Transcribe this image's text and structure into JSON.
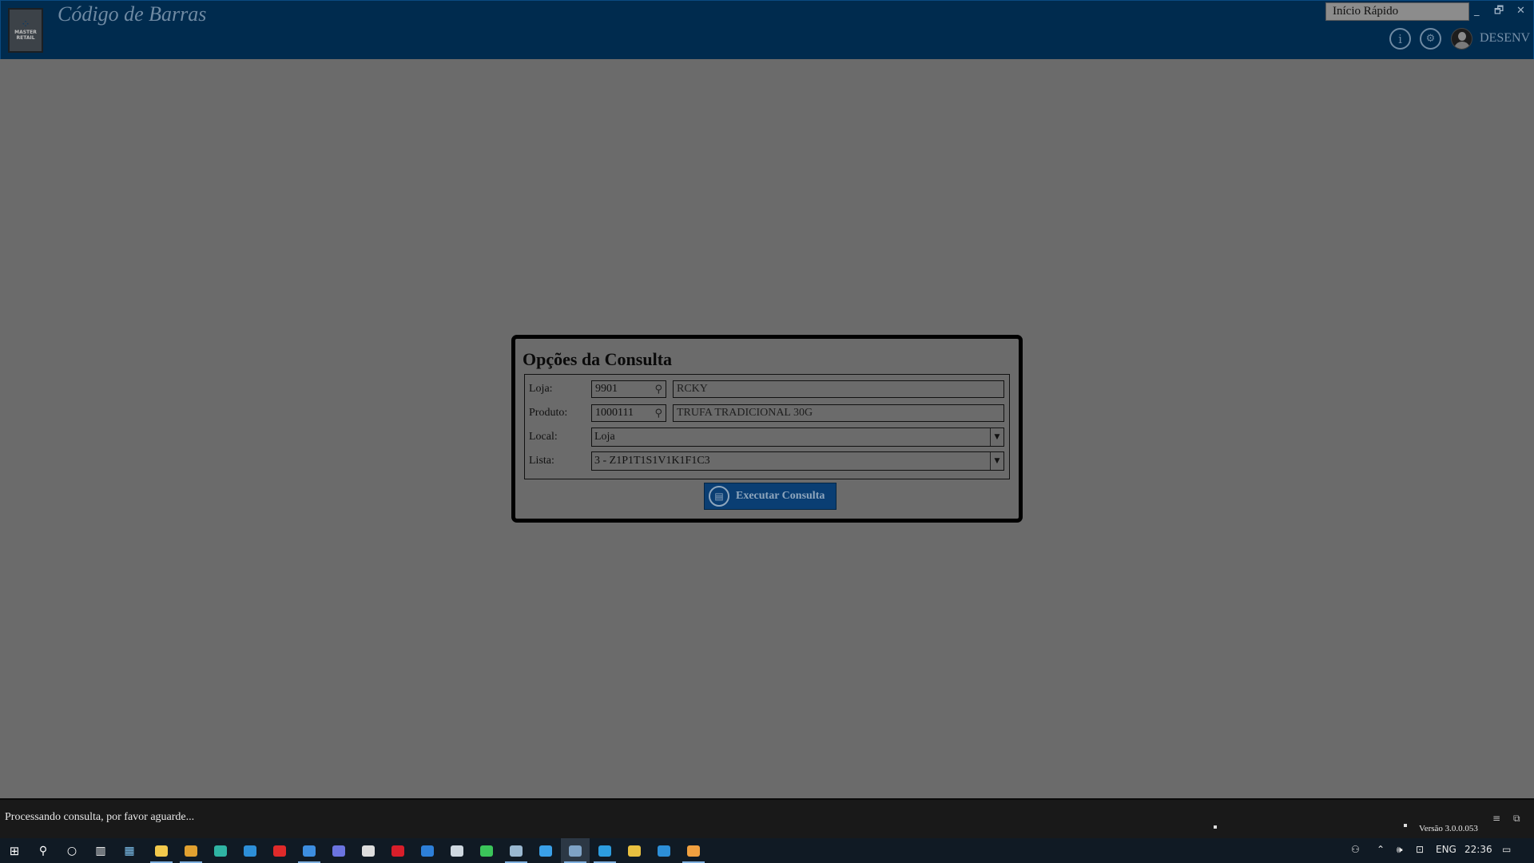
{
  "app": {
    "title": "Código de Barras",
    "logo_text": "MASTER RETAIL",
    "quick_start": "Início Rápido",
    "user": "DESENV",
    "window_controls": {
      "minimize": "_",
      "restore": "🗗",
      "close": "✕"
    }
  },
  "dialog": {
    "title": "Opções da Consulta",
    "loja": {
      "label": "Loja:",
      "code": "9901",
      "description": "RCKY"
    },
    "produto": {
      "label": "Produto:",
      "code": "1000111",
      "description": "TRUFA TRADICIONAL 30G"
    },
    "local": {
      "label": "Local:",
      "value": "Loja"
    },
    "lista": {
      "label": "Lista:",
      "value": "3 - Z1P1T1S1V1K1F1C3"
    },
    "execute_button": "Executar Consulta"
  },
  "status": {
    "message": "Processando consulta, por favor aguarde...",
    "version": "Versão 3.0.0.053"
  },
  "taskbar": {
    "apps": [
      {
        "name": "file-explorer-icon",
        "color": "#f2c94c",
        "running": true
      },
      {
        "name": "chrome-icon",
        "color": "#e0a030",
        "running": true
      },
      {
        "name": "edge-icon",
        "color": "#2fb4a3",
        "running": false
      },
      {
        "name": "vscode-icon",
        "color": "#2d8fd8",
        "running": false
      },
      {
        "name": "opera-icon",
        "color": "#e02a2a",
        "running": false
      },
      {
        "name": "mail-icon",
        "color": "#3d8ee0",
        "running": true
      },
      {
        "name": "discord-icon",
        "color": "#6b74e0",
        "running": false
      },
      {
        "name": "plane-icon",
        "color": "#dddddd",
        "running": false
      },
      {
        "name": "app-red-icon",
        "color": "#d81e2a",
        "running": false
      },
      {
        "name": "browser-blue-icon",
        "color": "#2d7fd8",
        "running": false
      },
      {
        "name": "github-icon",
        "color": "#cfd8e0",
        "running": false
      },
      {
        "name": "whatsapp-icon",
        "color": "#3bc55a",
        "running": false
      },
      {
        "name": "remote-desktop-icon",
        "color": "#9ab8d0",
        "running": true
      },
      {
        "name": "terminal-icon",
        "color": "#3aa0e8",
        "running": false
      },
      {
        "name": "master-retail-icon",
        "color": "#7fa3c6",
        "running": true,
        "active": true
      },
      {
        "name": "rdp-icon",
        "color": "#2d9de0",
        "running": true
      },
      {
        "name": "git-icon",
        "color": "#e8c040",
        "running": false
      },
      {
        "name": "vscode-2-icon",
        "color": "#2d8fd8",
        "running": false
      },
      {
        "name": "tool-icon",
        "color": "#f0a040",
        "running": true
      }
    ],
    "tray": {
      "language": "ENG",
      "time": "22:36"
    }
  }
}
